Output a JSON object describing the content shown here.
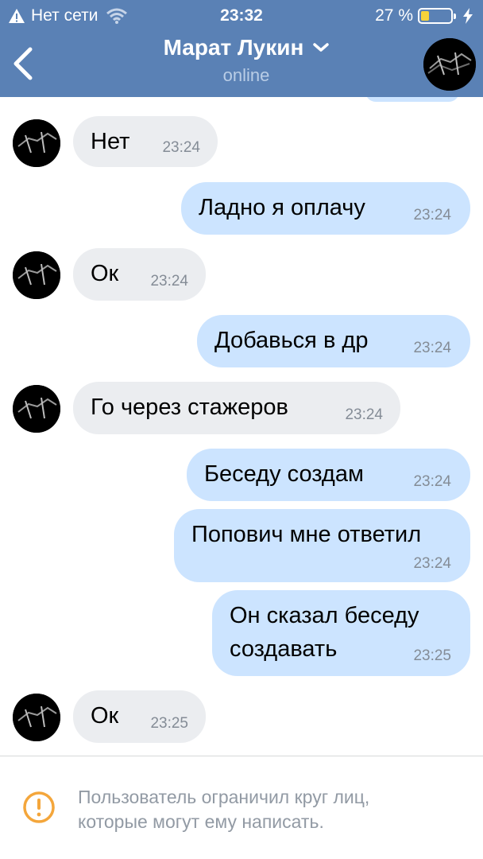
{
  "status_bar": {
    "network": "Нет сети",
    "time": "23:32",
    "battery": "27 %",
    "battery_level": 0.27
  },
  "header": {
    "title": "Марат Лукин",
    "subtitle": "online",
    "bg_color": "#5a81b5",
    "icons": [
      "warning-icon",
      "wifi-icon",
      "battery-icon",
      "charging-icon",
      "back-arrow-icon",
      "chevron-down-icon"
    ]
  },
  "messages": [
    {
      "direction": "in",
      "text": "Нет",
      "time": "23:24"
    },
    {
      "direction": "out",
      "text": "Ладно я оплачу",
      "time": "23:24"
    },
    {
      "direction": "in",
      "text": "Ок",
      "time": "23:24"
    },
    {
      "direction": "out",
      "text": "Добавься в др",
      "time": "23:24"
    },
    {
      "direction": "in",
      "text": "Го через стажеров",
      "time": "23:24"
    },
    {
      "direction": "out",
      "text": "Беседу создам",
      "time": "23:24"
    },
    {
      "direction": "out",
      "text": "Попович мне ответил",
      "time": "23:24"
    },
    {
      "direction": "out",
      "text": "Он сказал беседу создавать",
      "time": "23:25"
    },
    {
      "direction": "in",
      "text": "Ок",
      "time": "23:25"
    }
  ],
  "colors": {
    "incoming_bubble": "#ebedf0",
    "outgoing_bubble": "#cce4ff",
    "warning": "#f4a63b"
  },
  "notice": {
    "line1": "Пользователь ограничил круг лиц,",
    "line2": "которые могут ему написать."
  }
}
